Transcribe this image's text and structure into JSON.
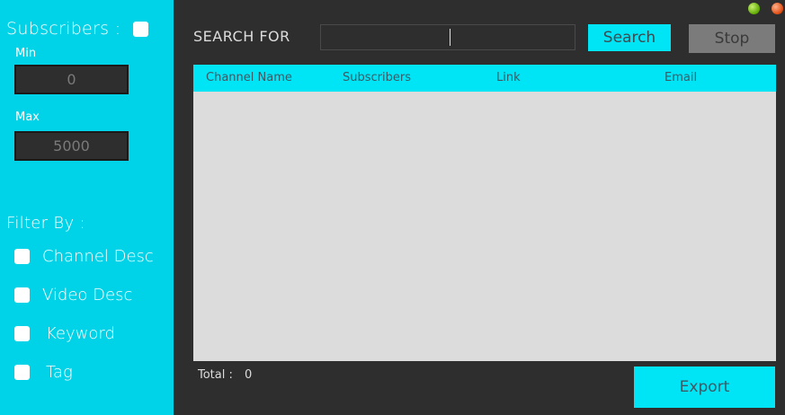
{
  "window": {
    "controls": [
      "minimize-dot",
      "close-dot"
    ],
    "colors": {
      "minimize": "#5fa800",
      "close": "#e04a10"
    }
  },
  "sidebar": {
    "subscribers_label": "Subscribers :",
    "subscribers_checked": false,
    "min_label": "Min",
    "min_value": "0",
    "max_label": "Max",
    "max_value": "5000",
    "filter_heading": "Filter By :",
    "filters": [
      {
        "label": "Channel Desc",
        "checked": false
      },
      {
        "label": "Video Desc",
        "checked": false
      },
      {
        "label": "Keyword",
        "checked": false
      },
      {
        "label": "Tag",
        "checked": false
      }
    ]
  },
  "search": {
    "label": "SEARCH FOR",
    "value": "",
    "search_button": "Search",
    "stop_button": "Stop"
  },
  "table": {
    "columns": [
      "Channel Name",
      "Subscribers",
      "Link",
      "Email"
    ],
    "rows": []
  },
  "footer": {
    "total_label": "Total :",
    "total_value": "0",
    "export_button": "Export"
  },
  "colors": {
    "accent": "#00e5f5",
    "sidebar_bg": "#00d3e8",
    "main_bg": "#2e2e2e",
    "table_bg": "#dcdcdc",
    "stop_button": "#7b7b7b"
  }
}
